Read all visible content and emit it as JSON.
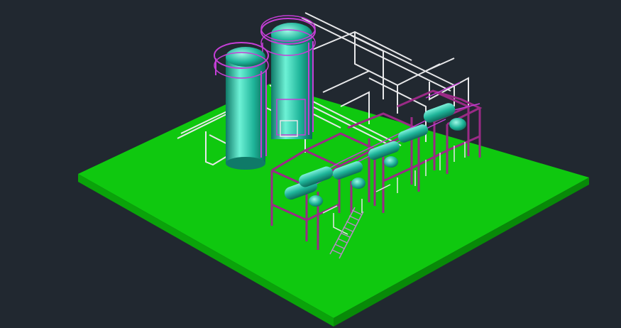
{
  "viewport": {
    "background": "#212830"
  },
  "scene": {
    "type": "isometric-3d-plant-model",
    "colors": {
      "ground_top": "#0fc80f",
      "ground_side": "#0a9e0a",
      "vessel": "#1fb59a",
      "vessel_highlight": "#6df2d6",
      "vessel_shadow": "#0f7a68",
      "structure": "#9a2a86",
      "piping": "#e8e8ea",
      "railing": "#c53fd6",
      "stair": "#b78bc7"
    },
    "objects": [
      "ground-slab",
      "tall-vertical-vessel",
      "short-vertical-vessel",
      "pipe-rack",
      "structural-frames",
      "horizontal-vessels",
      "access-stairway"
    ]
  }
}
